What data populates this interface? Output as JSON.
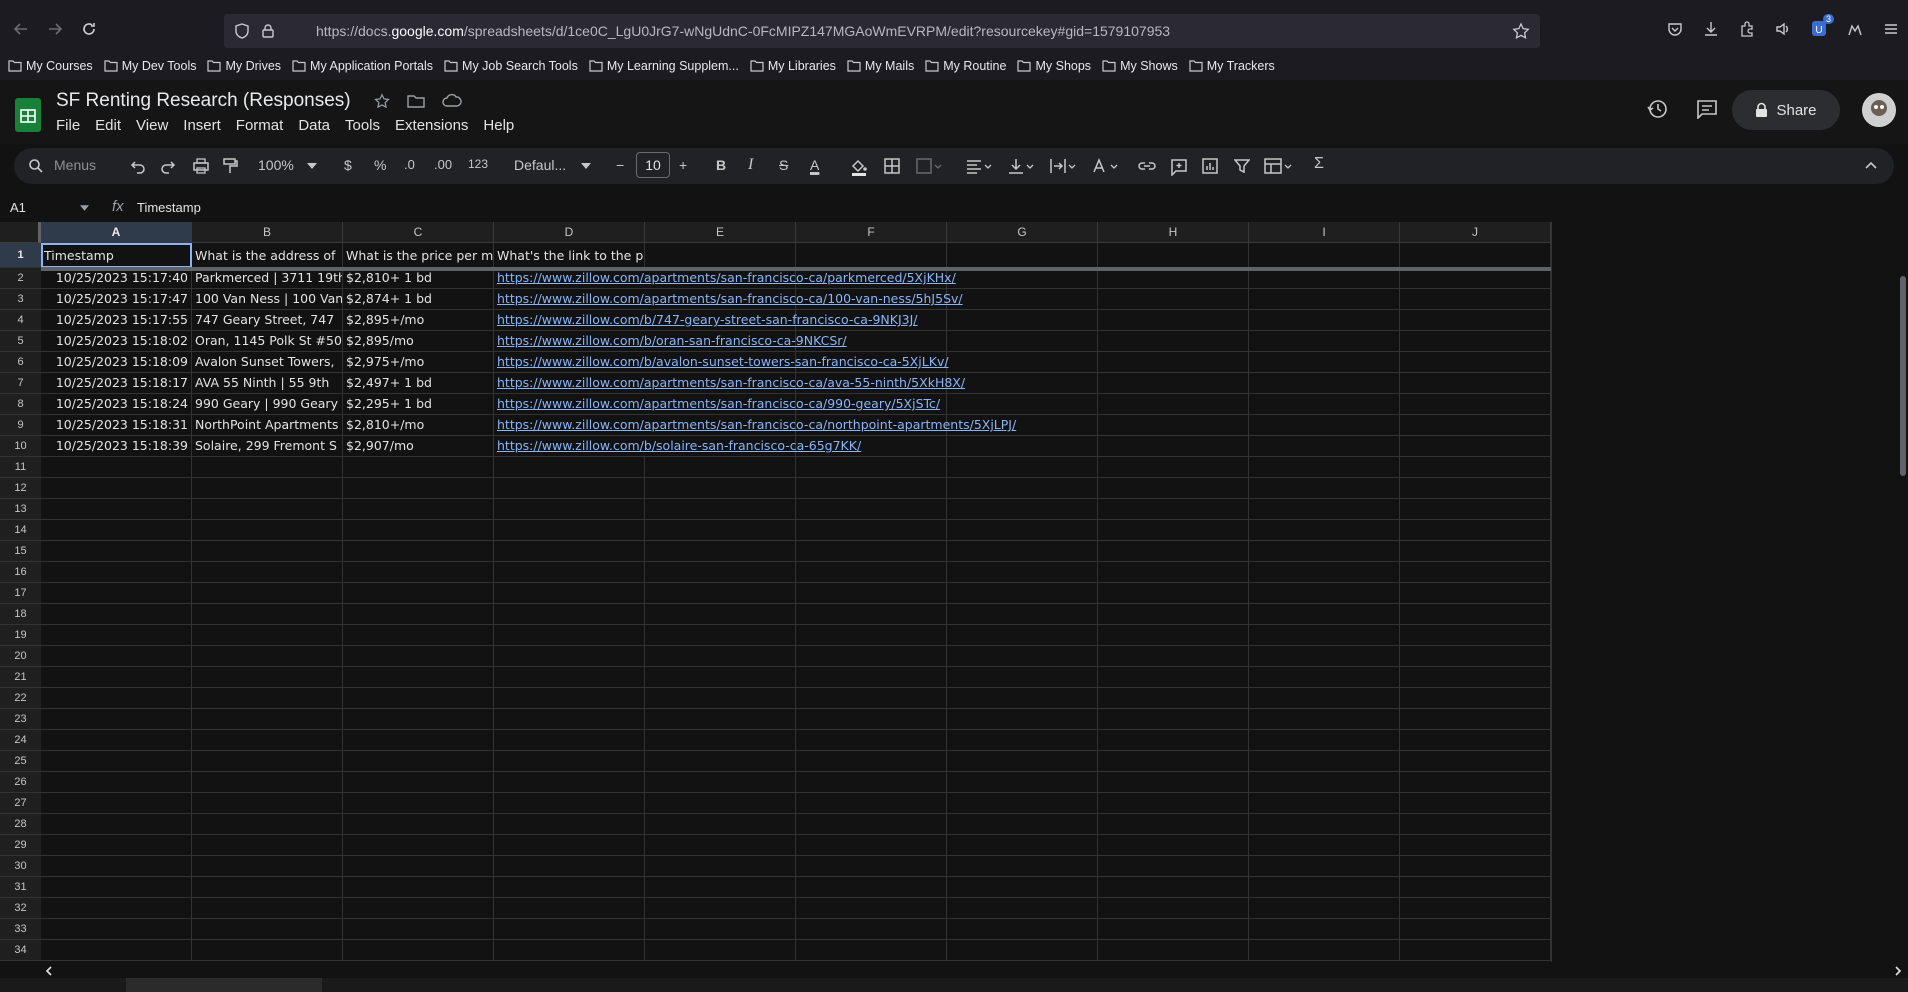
{
  "browser": {
    "url_prefix": "https://docs.",
    "url_domain": "google.com",
    "url_path": "/spreadsheets/d/1ce0C_LgU0JrG7-wNgUdnC-0FcMIPZ147MGAoWmEVRPM/edit?resourcekey#gid=1579107953",
    "extension_badge": "3",
    "bookmarks": [
      "My Courses",
      "My Dev Tools",
      "My Drives",
      "My Application Portals",
      "My Job Search Tools",
      "My Learning Supplem...",
      "My Libraries",
      "My Mails",
      "My Routine",
      "My Shops",
      "My Shows",
      "My Trackers"
    ]
  },
  "app": {
    "title": "SF Renting Research (Responses)",
    "menus": [
      "File",
      "Edit",
      "View",
      "Insert",
      "Format",
      "Data",
      "Tools",
      "Extensions",
      "Help"
    ],
    "share_label": "Share"
  },
  "toolbar": {
    "search_placeholder": "Menus",
    "zoom": "100%",
    "currency": "$",
    "percent": "%",
    "decimal_decrease": ".0",
    "decimal_increase": ".00",
    "number_format": "123",
    "font": "Defaul...",
    "font_size": "10",
    "bold": "B",
    "italic": "I",
    "strike": "S",
    "text_color": "A",
    "sum": "Σ"
  },
  "formula_bar": {
    "name_box": "A1",
    "fx": "fx",
    "value": "Timestamp"
  },
  "grid": {
    "columns": [
      "A",
      "B",
      "C",
      "D",
      "E",
      "F",
      "G",
      "H",
      "I",
      "J"
    ],
    "row_numbers": [
      "1",
      "2",
      "3",
      "4",
      "5",
      "6",
      "7",
      "8",
      "9",
      "10",
      "11",
      "12",
      "13",
      "14",
      "15",
      "16",
      "17",
      "18",
      "19",
      "20",
      "21",
      "22",
      "23",
      "24",
      "25",
      "26",
      "27",
      "28",
      "29",
      "30",
      "31",
      "32",
      "33",
      "34"
    ],
    "header_row": [
      "Timestamp",
      "What is the address of",
      "What is the price per m",
      "What's the link to the property?"
    ],
    "rows": [
      [
        "10/25/2023 15:17:40",
        "Parkmerced | 3711 19th",
        "$2,810+ 1 bd",
        "https://www.zillow.com/apartments/san-francisco-ca/parkmerced/5XjKHx/"
      ],
      [
        "10/25/2023 15:17:47",
        "100 Van Ness | 100 Van",
        "$2,874+ 1 bd",
        "https://www.zillow.com/apartments/san-francisco-ca/100-van-ness/5hJ5Sv/"
      ],
      [
        "10/25/2023 15:17:55",
        "747 Geary Street, 747",
        "$2,895+/mo",
        "https://www.zillow.com/b/747-geary-street-san-francisco-ca-9NKJ3J/"
      ],
      [
        "10/25/2023 15:18:02",
        "Oran, 1145 Polk St #50",
        "$2,895/mo",
        "https://www.zillow.com/b/oran-san-francisco-ca-9NKCSr/"
      ],
      [
        "10/25/2023 15:18:09",
        "Avalon Sunset Towers,",
        "$2,975+/mo",
        "https://www.zillow.com/b/avalon-sunset-towers-san-francisco-ca-5XjLKv/"
      ],
      [
        "10/25/2023 15:18:17",
        "AVA 55 Ninth | 55 9th",
        "$2,497+ 1 bd",
        "https://www.zillow.com/apartments/san-francisco-ca/ava-55-ninth/5XkH8X/"
      ],
      [
        "10/25/2023 15:18:24",
        "990 Geary | 990 Geary",
        "$2,295+ 1 bd",
        "https://www.zillow.com/apartments/san-francisco-ca/990-geary/5XjSTc/"
      ],
      [
        "10/25/2023 15:18:31",
        "NorthPoint Apartments",
        "$2,810+/mo",
        "https://www.zillow.com/apartments/san-francisco-ca/northpoint-apartments/5XjLPJ/"
      ],
      [
        "10/25/2023 15:18:39",
        "Solaire, 299 Fremont S",
        "$2,907/mo",
        "https://www.zillow.com/b/solaire-san-francisco-ca-65g7KK/"
      ]
    ]
  },
  "colors": {
    "link": "#8ab4f8",
    "selection": "#8ab4f8",
    "sheets_green": "#188038"
  }
}
